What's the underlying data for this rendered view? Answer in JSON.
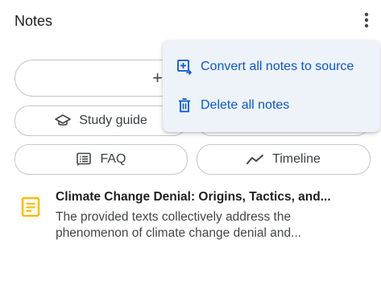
{
  "panel": {
    "title": "Notes"
  },
  "toolbar": {
    "more_icon": "more-vert-icon"
  },
  "add_note": {
    "label": "+"
  },
  "chips": {
    "study_guide": {
      "label": "Study guide",
      "icon": "graduation-cap-icon"
    },
    "faq": {
      "label": "FAQ",
      "icon": "faq-icon"
    },
    "timeline": {
      "label": "Timeline",
      "icon": "timeline-icon"
    }
  },
  "menu": {
    "items": [
      {
        "label": "Convert all notes to source",
        "icon": "convert-to-source-icon"
      },
      {
        "label": "Delete all notes",
        "icon": "trash-icon"
      }
    ]
  },
  "notes": [
    {
      "title": "Climate Change Denial: Origins, Tactics, and...",
      "snippet": "The provided texts collectively address the phenomenon of climate change denial and...",
      "icon": "note-icon"
    }
  ],
  "colors": {
    "accent": "#0b57d0",
    "note_icon": "#fbbc04",
    "menu_bg": "#eef3f9"
  }
}
